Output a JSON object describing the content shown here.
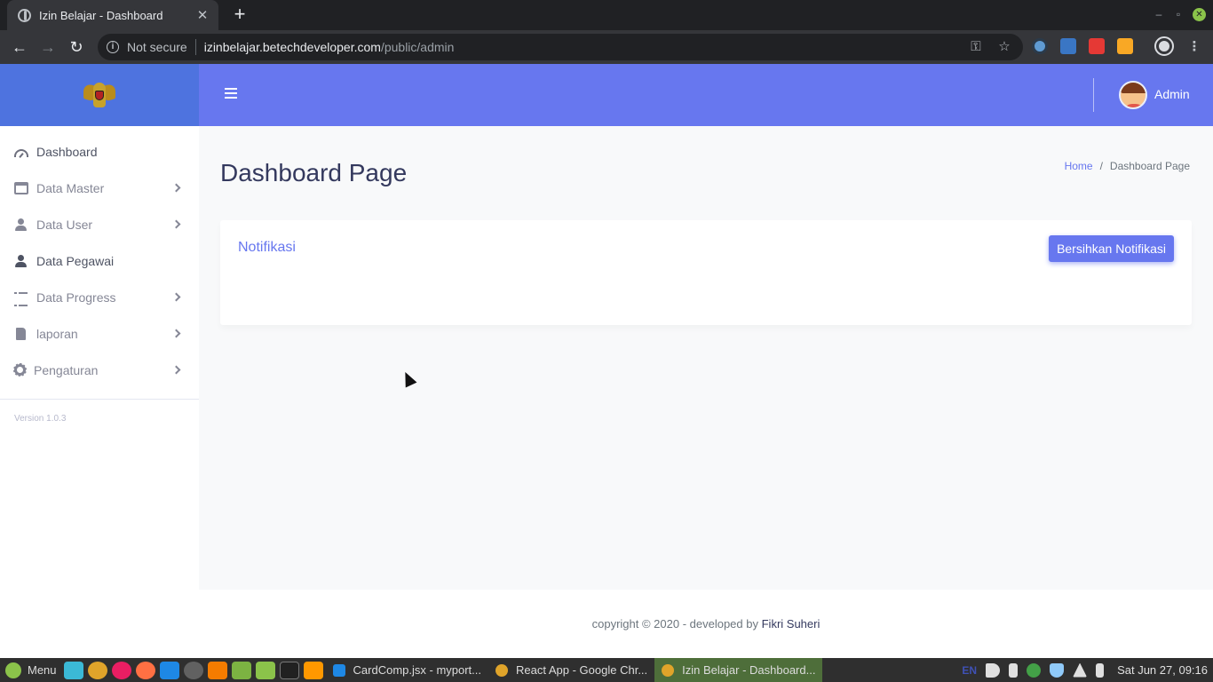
{
  "browser": {
    "tab_title": "Izin Belajar - Dashboard",
    "tab_close": "✕",
    "new_tab": "+",
    "security_label": "Not secure",
    "url_host": "izinbelajar.betechdeveloper.com",
    "url_path": "/public/admin"
  },
  "sidebar": {
    "items": [
      {
        "label": "Dashboard",
        "icon": "gauge-icon",
        "active": true,
        "has_submenu": false
      },
      {
        "label": "Data Master",
        "icon": "window-icon",
        "active": false,
        "has_submenu": true
      },
      {
        "label": "Data User",
        "icon": "users-icon",
        "active": false,
        "has_submenu": true
      },
      {
        "label": "Data Pegawai",
        "icon": "users-icon",
        "active": true,
        "has_submenu": false
      },
      {
        "label": "Data Progress",
        "icon": "tasks-icon",
        "active": false,
        "has_submenu": true
      },
      {
        "label": "laporan",
        "icon": "file-icon",
        "active": false,
        "has_submenu": true
      },
      {
        "label": "Pengaturan",
        "icon": "gear-icon",
        "active": false,
        "has_submenu": true
      }
    ],
    "version": "Version 1.0.3"
  },
  "topbar": {
    "user_name": "Admin"
  },
  "main": {
    "page_title": "Dashboard Page",
    "breadcrumb": {
      "home": "Home",
      "separator": "/",
      "current": "Dashboard Page"
    },
    "card": {
      "title": "Notifikasi",
      "clear_button": "Bersihkan Notifikasi"
    }
  },
  "footer": {
    "copyright": "copyright © 2020 - developed by ",
    "developer": "Fikri Suheri"
  },
  "taskbar": {
    "menu_label": "Menu",
    "tasks": [
      {
        "label": "CardComp.jsx - myport...",
        "active": false
      },
      {
        "label": "React App - Google Chr...",
        "active": false
      },
      {
        "label": "Izin Belajar - Dashboard...",
        "active": true
      }
    ],
    "keyboard_layout": "EN",
    "clock": "Sat Jun 27, 09:16"
  },
  "colors": {
    "brand": "#4e73df",
    "topbar": "#6777ef",
    "accent": "#6777ef",
    "taskbar_active": "#4e6e3a"
  }
}
